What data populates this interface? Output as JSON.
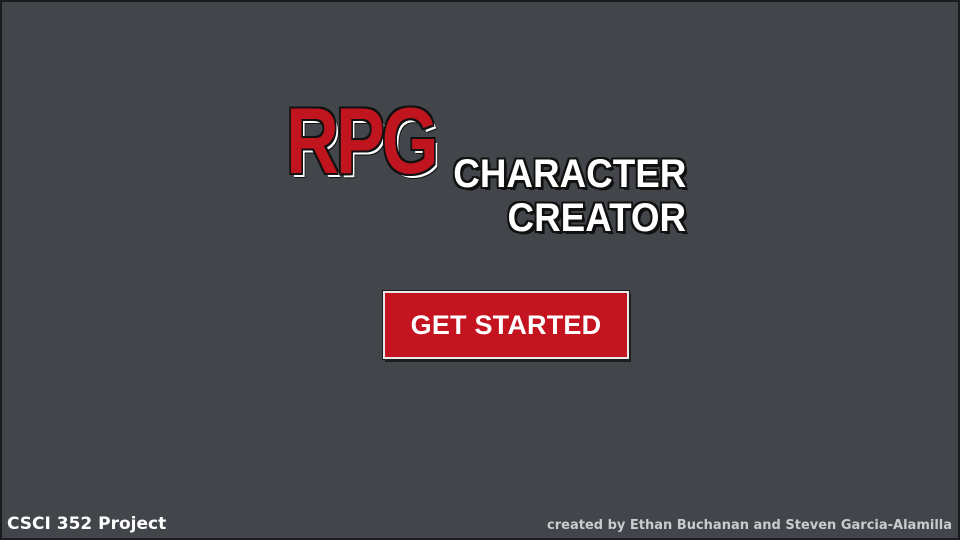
{
  "title": {
    "rpg": "RPG",
    "line1": "CHARACTER",
    "line2": "CREATOR"
  },
  "start_button": {
    "label": "GET STARTED"
  },
  "footer": {
    "project": "CSCI 352 Project",
    "credits": "created by Ethan Buchanan and Steven Garcia-Alamilla"
  },
  "colors": {
    "background": "#42454a",
    "accent_red": "#c41420",
    "text_white": "#ffffff",
    "credits_gray": "#c9cbce"
  }
}
